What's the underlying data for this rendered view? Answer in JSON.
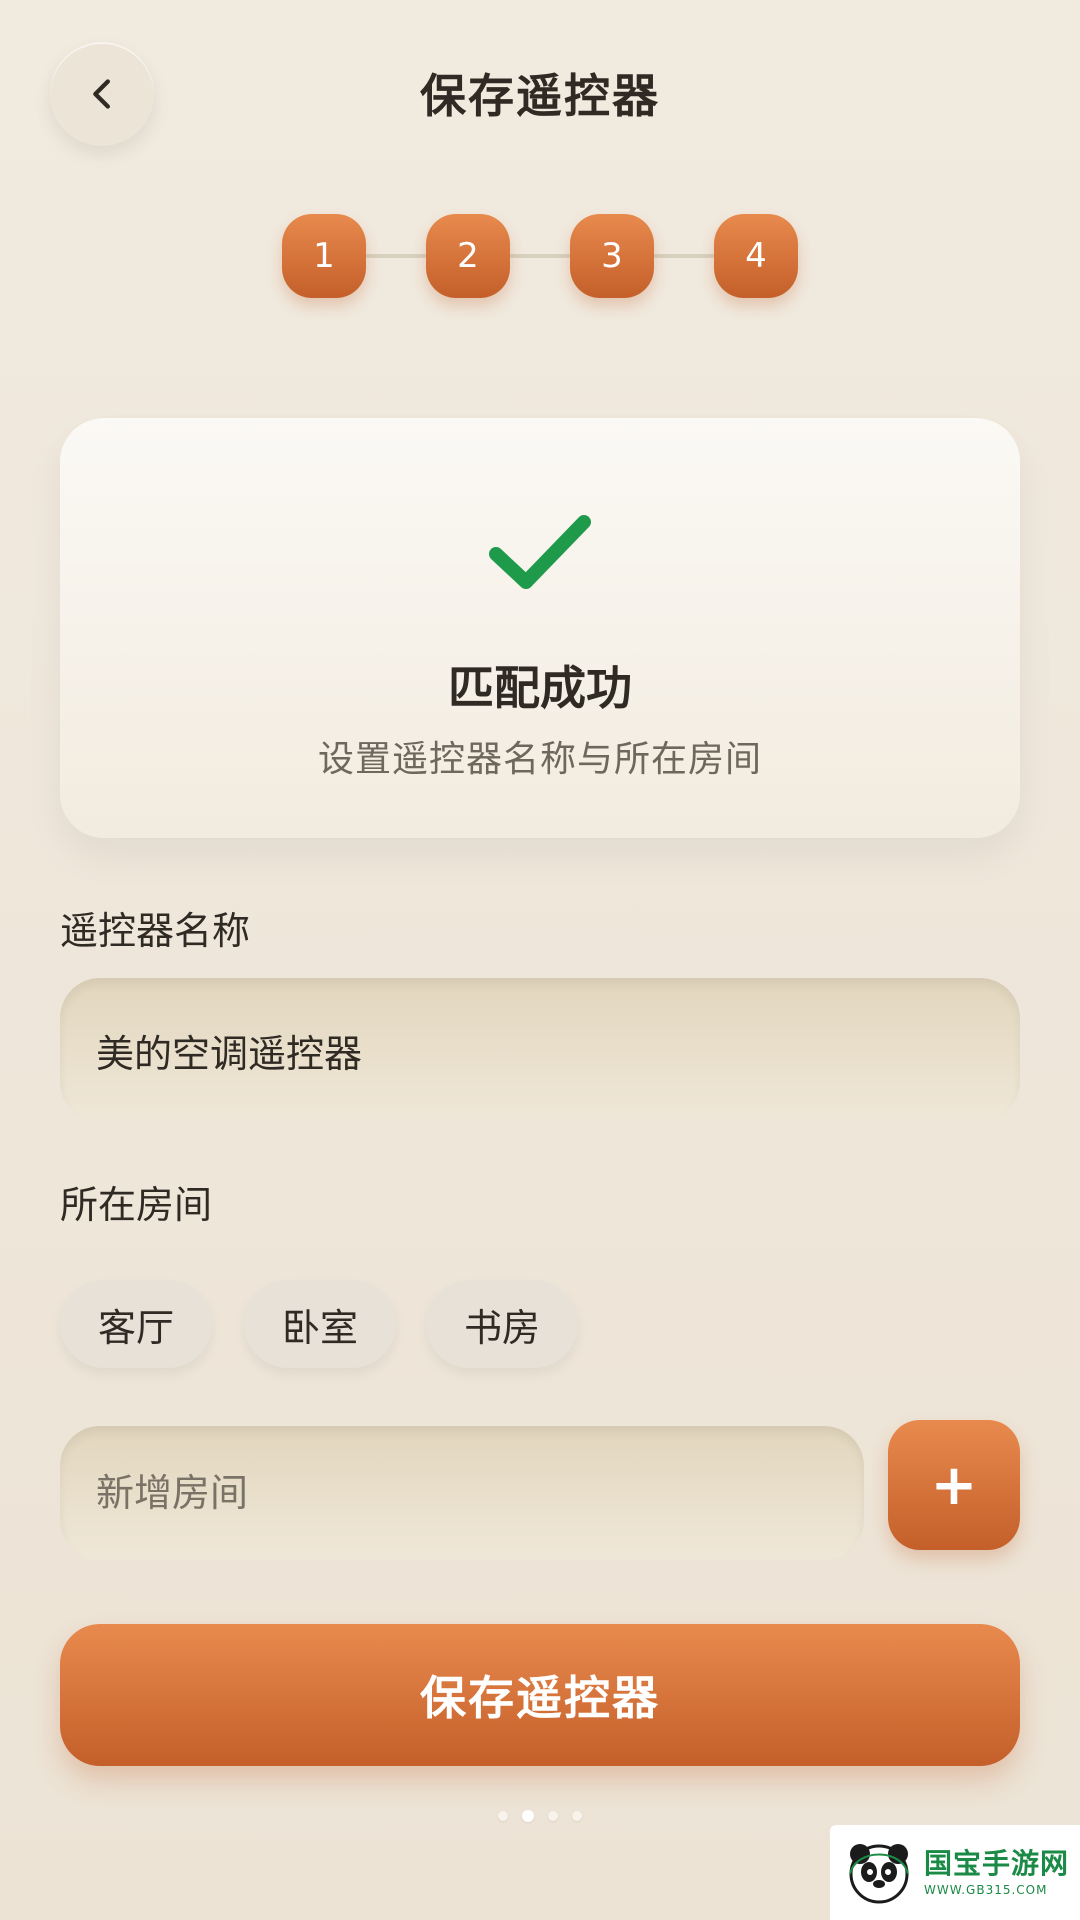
{
  "header": {
    "title": "保存遥控器",
    "back_icon": "chevron-left-icon"
  },
  "steps": [
    "1",
    "2",
    "3",
    "4"
  ],
  "success": {
    "title": "匹配成功",
    "subtitle": "设置遥控器名称与所在房间",
    "icon": "check-icon",
    "accent": "#1f9a4b"
  },
  "form": {
    "name_label": "遥控器名称",
    "name_value": "美的空调遥控器",
    "room_label": "所在房间",
    "rooms": [
      "客厅",
      "卧室",
      "书房"
    ],
    "new_room_placeholder": "新增房间",
    "add_label": "+",
    "save_label": "保存遥控器"
  },
  "colors": {
    "primary": "#d46d35",
    "background": "#efe7da",
    "text": "#2f2a24"
  },
  "watermark": {
    "title": "国宝手游网",
    "url": "WWW.GB315.COM"
  }
}
